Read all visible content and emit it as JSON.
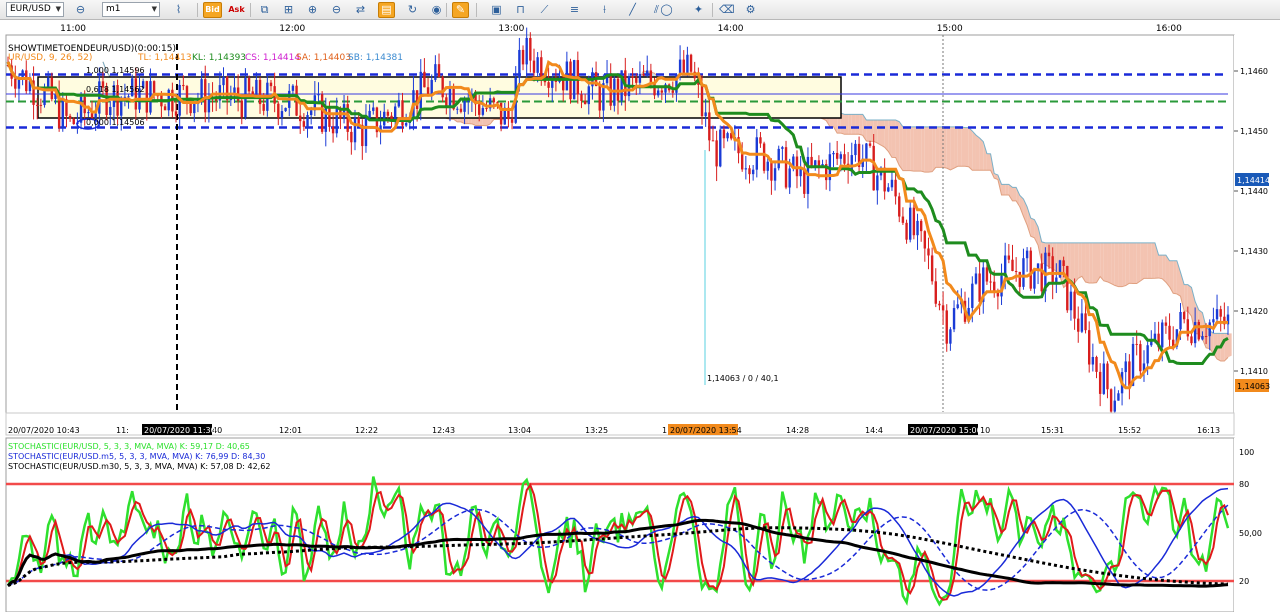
{
  "toolbar": {
    "symbol": "EUR/USD",
    "timeframe": "m1",
    "bid_label": "Bid",
    "ask_label": "Ask",
    "icons": [
      "chart-link-icon",
      "chart-type-icon",
      "tick-mode-icon",
      "objects-icon",
      "crosshair-icon",
      "zoom-in-icon",
      "zoom-out-icon",
      "zoom-fit-icon",
      "scroll-icon",
      "highlight-icon",
      "comment-icon",
      "rotate-icon",
      "globe-icon",
      "pencil-icon",
      "image-icon",
      "magnet-icon",
      "line-tools-icon",
      "lines-icon",
      "fib-icon",
      "trend-icon",
      "channel-icon",
      "shape-icon",
      "text-icon",
      "eraser-icon",
      "settings-icon"
    ]
  },
  "time_axis_top": [
    "11:00",
    "12:00",
    "13:00",
    "14:00",
    "15:00",
    "16:00"
  ],
  "main_chart": {
    "header_line1": "SHOWTIMETOENDEUR/USD)(0:00:15)",
    "header_line2": {
      "prefix": "ICH",
      "prefix2": "UR/USD, 9, 26, 52)",
      "tl": "TL: 1,14413",
      "kl": "KL: 1,14393",
      "cs": "CS: 1,14414",
      "sa": "SA: 1,14403",
      "sb": "SB: 1,14381"
    },
    "fib_labels": [
      "1,000  1,14596",
      "0,618  1,14562",
      "0,000  1,14506"
    ],
    "crosshair_label": "1,14063 / 0 / 40,1",
    "price_ticks": [
      "1,1460",
      "1,1450",
      "1,1440",
      "1,1430",
      "1,1420",
      "1,1410"
    ],
    "price_box_current": "1,14414",
    "price_box_low": "1,14063",
    "time_ticks": [
      "20/07/2020 10:43",
      "11:",
      "40",
      "12:01",
      "12:22",
      "12:43",
      "13:04",
      "13:25",
      "1",
      "14:07",
      "14:28",
      "14:4",
      "10",
      "15:31",
      "15:52",
      "16:13"
    ],
    "time_cursor_labels": [
      "20/07/2020 11:30",
      "20/07/2020 13:54",
      "20/07/2020 15:00"
    ],
    "colors": {
      "tenkan": "#f28a1c",
      "kijun": "#1e8c1e",
      "fib": "#1a2ad8",
      "cloud_bull": "#c9e3ea",
      "cloud_bear": "#f3c3b1",
      "bull_candle": "#1a3bd6",
      "bear_candle": "#d81e1e"
    }
  },
  "stoch_panel": {
    "line1": "STOCHASTIC(EUR/USD, 5, 3, 3, MVA, MVA)  K: 59,17  D: 40,65",
    "line2": "STOCHASTIC(EUR/USD.m5, 5, 3, 3, MVA, MVA)  K: 76,99  D: 84,30",
    "line3": "STOCHASTIC(EUR/USD.m30, 5, 3, 3, MVA, MVA)  K: 57,08  D: 42,62",
    "levels": [
      "100",
      "80",
      "50,00",
      "20"
    ],
    "colors": {
      "m1_k": "#2ee02e",
      "m1_d": "#e01a1a",
      "m5": "#1a2ad8",
      "m30": "#000000",
      "band": "#f24a4a"
    }
  },
  "chart_data": [
    {
      "type": "candlestick",
      "title": "EUR/USD m1",
      "ylim": [
        1.1403,
        1.1466
      ],
      "x_range": [
        "10:43",
        "16:17"
      ],
      "close_samples": [
        {
          "t": "10:43",
          "v": 1.1461
        },
        {
          "t": "10:55",
          "v": 1.1455
        },
        {
          "t": "11:00",
          "v": 1.1451
        },
        {
          "t": "11:10",
          "v": 1.1456
        },
        {
          "t": "11:30",
          "v": 1.1456
        },
        {
          "t": "12:00",
          "v": 1.1455
        },
        {
          "t": "12:20",
          "v": 1.145
        },
        {
          "t": "12:40",
          "v": 1.1458
        },
        {
          "t": "13:00",
          "v": 1.1452
        },
        {
          "t": "13:04",
          "v": 1.1463
        },
        {
          "t": "13:25",
          "v": 1.1456
        },
        {
          "t": "13:50",
          "v": 1.146
        },
        {
          "t": "13:56",
          "v": 1.1447
        },
        {
          "t": "14:10",
          "v": 1.1446
        },
        {
          "t": "14:20",
          "v": 1.1442
        },
        {
          "t": "14:35",
          "v": 1.1447
        },
        {
          "t": "14:45",
          "v": 1.144
        },
        {
          "t": "14:55",
          "v": 1.1428
        },
        {
          "t": "15:00",
          "v": 1.1418
        },
        {
          "t": "15:10",
          "v": 1.1425
        },
        {
          "t": "15:20",
          "v": 1.1427
        },
        {
          "t": "15:31",
          "v": 1.1426
        },
        {
          "t": "15:40",
          "v": 1.1412
        },
        {
          "t": "15:45",
          "v": 1.1406
        },
        {
          "t": "15:52",
          "v": 1.1412
        },
        {
          "t": "16:05",
          "v": 1.1418
        },
        {
          "t": "16:17",
          "v": 1.1418
        }
      ],
      "horizontal_levels": [
        1.14596,
        1.14562,
        1.14506
      ],
      "fib_anchor": "1,000 1,14596 / 0,618 1,14562 / 0,000 1,14506"
    },
    {
      "type": "line",
      "title": "STOCHASTIC",
      "ylim": [
        0,
        100
      ],
      "levels": [
        20,
        80
      ],
      "series": [
        {
          "name": "STOCHASTIC(EUR/USD, 5, 3, 3, MVA, MVA) K",
          "last": 59.17
        },
        {
          "name": "STOCHASTIC(EUR/USD, 5, 3, 3, MVA, MVA) D",
          "last": 40.65
        },
        {
          "name": "STOCHASTIC(EUR/USD.m5, 5, 3, 3, MVA, MVA) K",
          "last": 76.99
        },
        {
          "name": "STOCHASTIC(EUR/USD.m5, 5, 3, 3, MVA, MVA) D",
          "last": 84.3
        },
        {
          "name": "STOCHASTIC(EUR/USD.m30, 5, 3, 3, MVA, MVA) K",
          "last": 57.08
        },
        {
          "name": "STOCHASTIC(EUR/USD.m30, 5, 3, 3, MVA, MVA) D",
          "last": 42.62
        }
      ]
    }
  ]
}
